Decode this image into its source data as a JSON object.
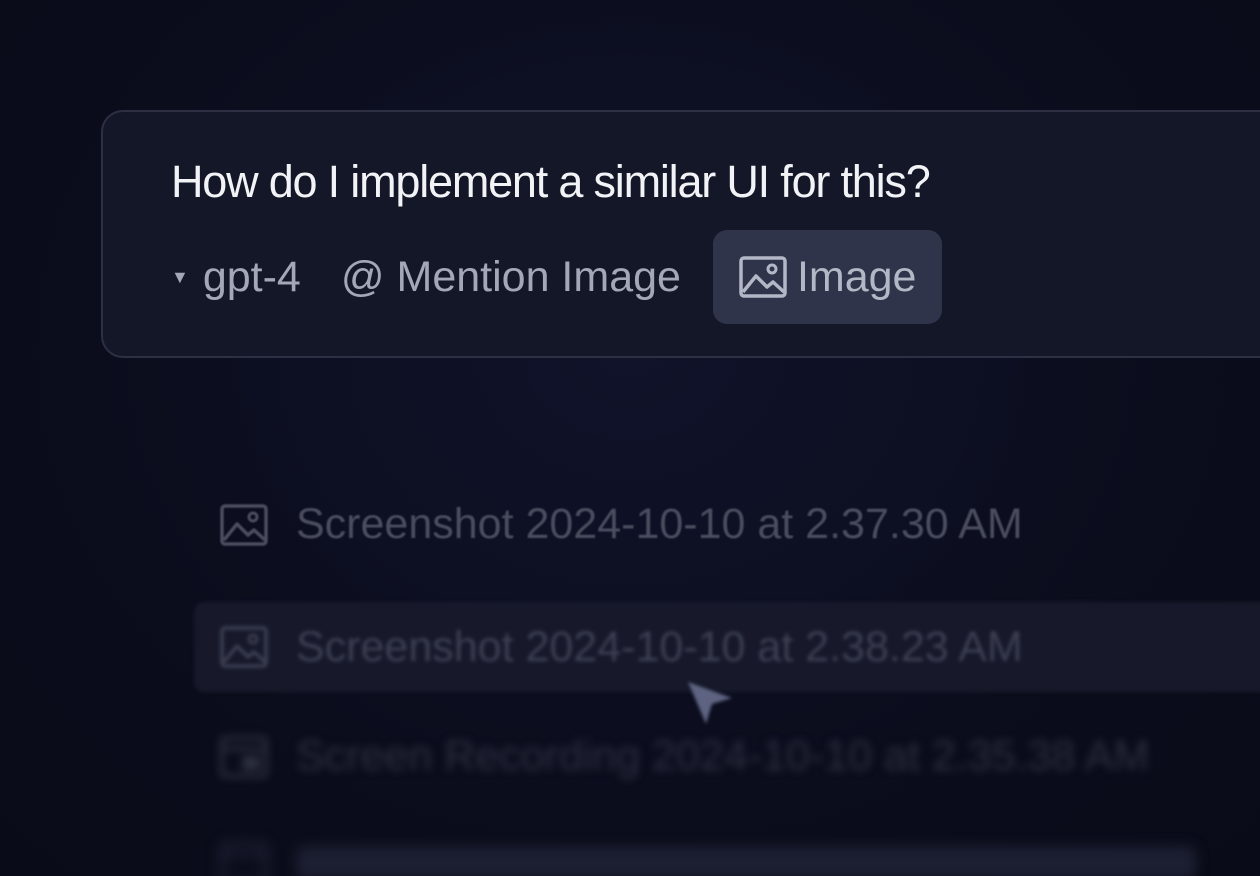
{
  "composer": {
    "prompt": "How do I implement a similar UI for this?",
    "model": "gpt-4",
    "mention_label": "Mention Image",
    "mention_symbol": "@",
    "image_button_label": "Image",
    "image_icon": "image-icon",
    "caret_icon": "triangle-down-icon"
  },
  "file_list": [
    {
      "name": "Screenshot 2024-10-10 at 2.37.30 AM",
      "icon": "image-icon"
    },
    {
      "name": "Screenshot 2024-10-10 at 2.38.23 AM",
      "icon": "image-icon",
      "hovered": true
    },
    {
      "name": "Screen Recording 2024-10-10 at 2.35.38 AM",
      "icon": "video-icon"
    }
  ],
  "colors": {
    "background": "#0b0d1d",
    "composer_bg": "#141727",
    "composer_border": "#2c3042",
    "prompt_text": "#f2f3f7",
    "toolbar_text": "#a4a7b8",
    "image_button_bg": "#30344a"
  }
}
